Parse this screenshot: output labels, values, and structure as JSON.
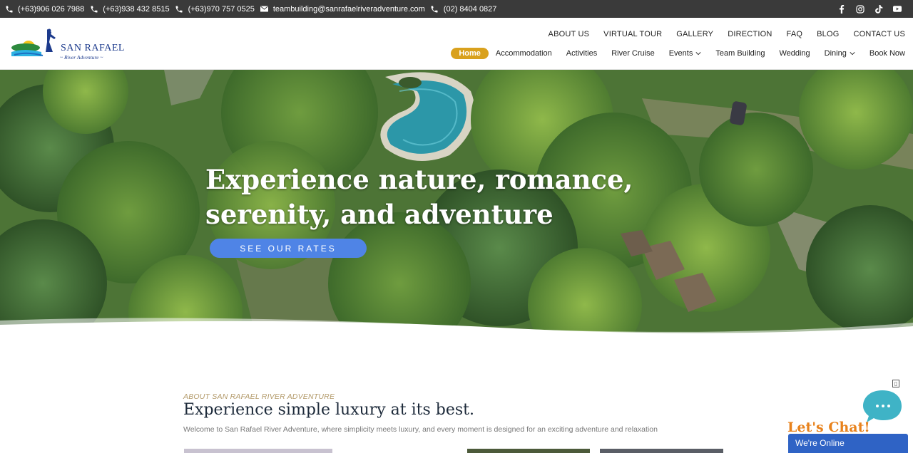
{
  "topbar": {
    "contacts": [
      {
        "type": "phone-icon",
        "text": "(+63)906 026 7988"
      },
      {
        "type": "phone-icon",
        "text": "(+63)938 432 8515"
      },
      {
        "type": "phone-icon",
        "text": "(+63)970 757 0525"
      },
      {
        "type": "email-icon",
        "text": "teambuilding@sanrafaelriveradventure.com"
      },
      {
        "type": "phone-icon",
        "text": "(02) 8404 0827"
      }
    ],
    "socials": [
      "facebook-icon",
      "instagram-icon",
      "tiktok-icon",
      "youtube-icon"
    ]
  },
  "logo": {
    "title": "SAN RAFAEL",
    "subtitle": "River Adventure"
  },
  "nav_top": [
    "ABOUT US",
    "VIRTUAL TOUR",
    "GALLERY",
    "DIRECTION",
    "FAQ",
    "BLOG",
    "CONTACT US"
  ],
  "nav_main": [
    {
      "label": "Home",
      "active": true
    },
    {
      "label": "Accommodation"
    },
    {
      "label": "Activities"
    },
    {
      "label": "River Cruise"
    },
    {
      "label": "Events",
      "dropdown": true
    },
    {
      "label": "Team Building"
    },
    {
      "label": "Wedding"
    },
    {
      "label": "Dining",
      "dropdown": true
    },
    {
      "label": "Book Now"
    }
  ],
  "hero": {
    "title_line1": "Experience nature, romance,",
    "title_line2": "serenity, and adventure",
    "button": "SEE OUR RATES"
  },
  "about": {
    "eyebrow": "ABOUT SAN RAFAEL RIVER ADVENTURE",
    "title": "Experience simple luxury at its best.",
    "description": "Welcome to San Rafael River Adventure, where simplicity meets luxury, and every moment is designed for an exciting adventure and relaxation"
  },
  "chat": {
    "close": "▯",
    "lets_chat": "Let's Chat!",
    "status": "We're Online"
  },
  "colors": {
    "topbar": "#3a3a3a",
    "accent": "#d9a11d",
    "button": "#4f84e6",
    "chat_bar": "#2f63c5",
    "chat_bubble": "#3fb3c6",
    "chat_text": "#e8821c"
  }
}
